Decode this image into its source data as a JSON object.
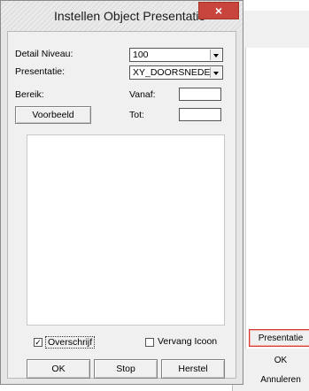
{
  "background_window": {
    "buttons": {
      "presentatie": "Presentatie",
      "ok": "OK",
      "annuleren": "Annuleren"
    }
  },
  "dialog": {
    "title": "Instellen Object Presentatie",
    "close_symbol": "×",
    "detail_niveau": {
      "label": "Detail Niveau:",
      "value": "100"
    },
    "presentatie": {
      "label": "Presentatie:",
      "value": "XY_DOORSNEDE"
    },
    "bereik": {
      "label": "Bereik:",
      "vanaf_label": "Vanaf:",
      "vanaf_value": "",
      "tot_label": "Tot:",
      "tot_value": ""
    },
    "voorbeeld_button": "Voorbeeld",
    "overschrijf": {
      "label": "Overschrijf",
      "checked": true,
      "mark": "✓"
    },
    "vervang_icoon": {
      "label": "Vervang Icoon",
      "checked": false
    },
    "buttons": {
      "ok": "OK",
      "stop": "Stop",
      "herstel": "Herstel"
    }
  }
}
